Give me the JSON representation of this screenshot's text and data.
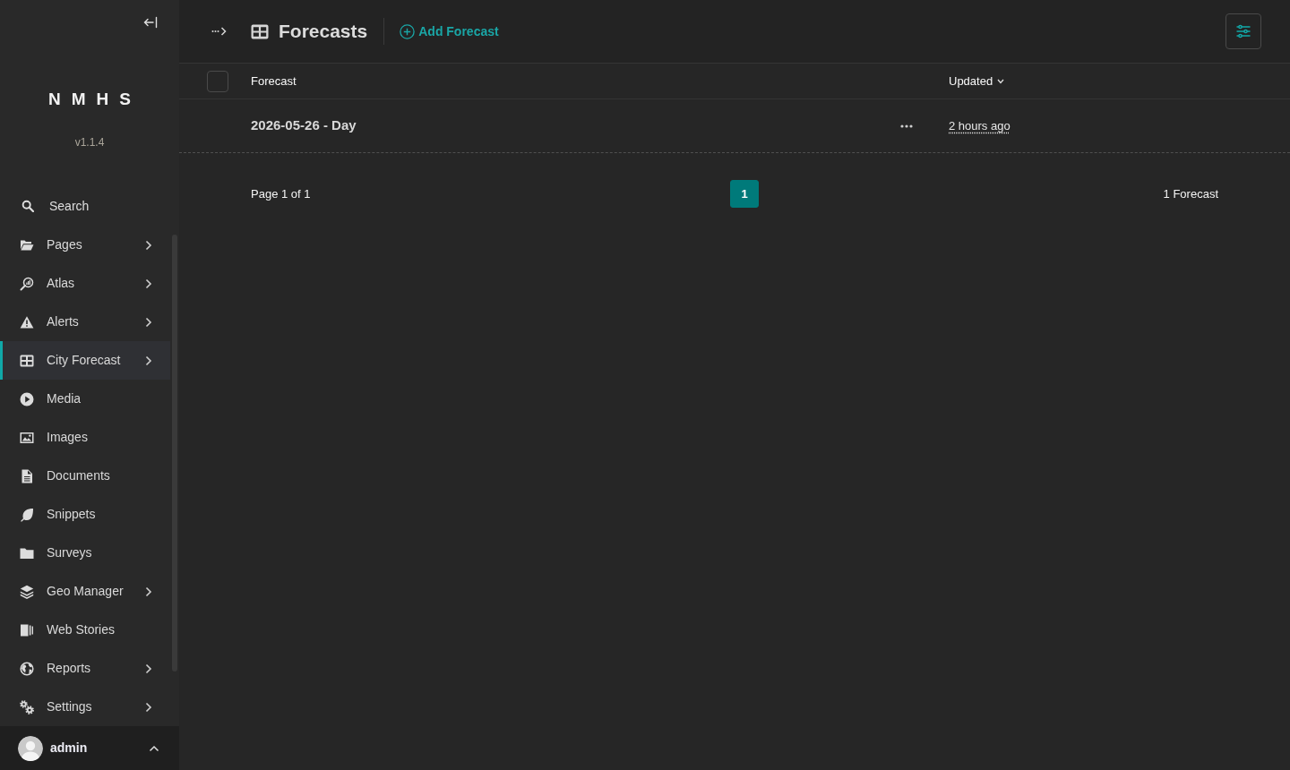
{
  "sidebar": {
    "brand": "NMHS",
    "version": "v1.1.4",
    "search": {
      "label": "Search"
    },
    "items": [
      {
        "label": "Pages",
        "submenu": true,
        "selected": false
      },
      {
        "label": "Atlas",
        "submenu": true,
        "selected": false
      },
      {
        "label": "Alerts",
        "submenu": true,
        "selected": false
      },
      {
        "label": "City Forecast",
        "submenu": true,
        "selected": true
      },
      {
        "label": "Media",
        "submenu": false,
        "selected": false
      },
      {
        "label": "Images",
        "submenu": false,
        "selected": false
      },
      {
        "label": "Documents",
        "submenu": false,
        "selected": false
      },
      {
        "label": "Snippets",
        "submenu": false,
        "selected": false
      },
      {
        "label": "Surveys",
        "submenu": false,
        "selected": false
      },
      {
        "label": "Geo Manager",
        "submenu": true,
        "selected": false
      },
      {
        "label": "Web Stories",
        "submenu": false,
        "selected": false
      },
      {
        "label": "Reports",
        "submenu": true,
        "selected": false
      },
      {
        "label": "Settings",
        "submenu": true,
        "selected": false
      }
    ],
    "user": {
      "name": "admin"
    }
  },
  "header": {
    "title": "Forecasts",
    "add_action": "Add Forecast"
  },
  "table": {
    "select_all": {
      "checked": false
    },
    "columns": [
      {
        "label": "Forecast",
        "sorted": false
      },
      {
        "label": "Updated",
        "sorted": true
      }
    ],
    "rows": [
      {
        "title": "2026-05-26 - Day",
        "updated": "2 hours ago"
      }
    ]
  },
  "pagination": {
    "summary": "Page 1 of 1",
    "pages": [
      {
        "label": "1",
        "selected": true
      }
    ],
    "count": "1 Forecast"
  }
}
